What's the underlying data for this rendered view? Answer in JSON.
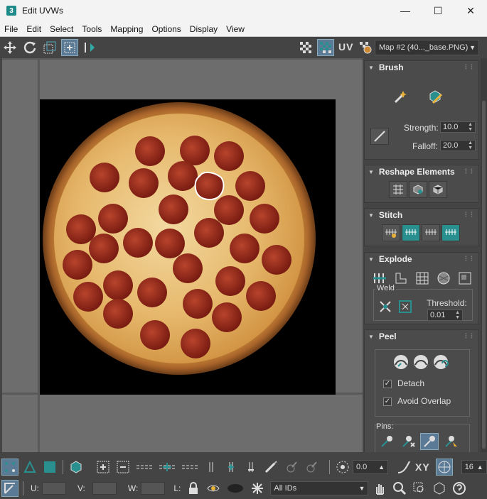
{
  "window": {
    "title": "Edit UVWs",
    "app_badge": "3"
  },
  "menu": [
    "File",
    "Edit",
    "Select",
    "Tools",
    "Mapping",
    "Options",
    "Display",
    "View"
  ],
  "toolbar": {
    "uv_label": "UV",
    "map_select": "Map #2 (40..._base.PNG)"
  },
  "panel": {
    "brush": {
      "title": "Brush",
      "strength_label": "Strength:",
      "strength": "10.0",
      "falloff_label": "Falloff:",
      "falloff": "20.0"
    },
    "reshape": {
      "title": "Reshape Elements"
    },
    "stitch": {
      "title": "Stitch"
    },
    "explode": {
      "title": "Explode",
      "weld_label": "Weld",
      "threshold_label": "Threshold:",
      "threshold": "0.01"
    },
    "peel": {
      "title": "Peel",
      "detach_label": "Detach",
      "detach_checked": true,
      "avoid_overlap_label": "Avoid Overlap",
      "avoid_overlap_checked": true,
      "pins_label": "Pins:"
    }
  },
  "bottom": {
    "angle_value": "0.0",
    "xy_label": "XY",
    "grid_value": "16",
    "u_label": "U:",
    "v_label": "V:",
    "w_label": "W:",
    "l_label": "L:",
    "ids_select": "All IDs"
  },
  "colors": {
    "accent_teal": "#2a8f8f",
    "viewport_bg": "#6d6d6d",
    "panel_bg": "#444444",
    "selection_outline": "#ffffff"
  }
}
